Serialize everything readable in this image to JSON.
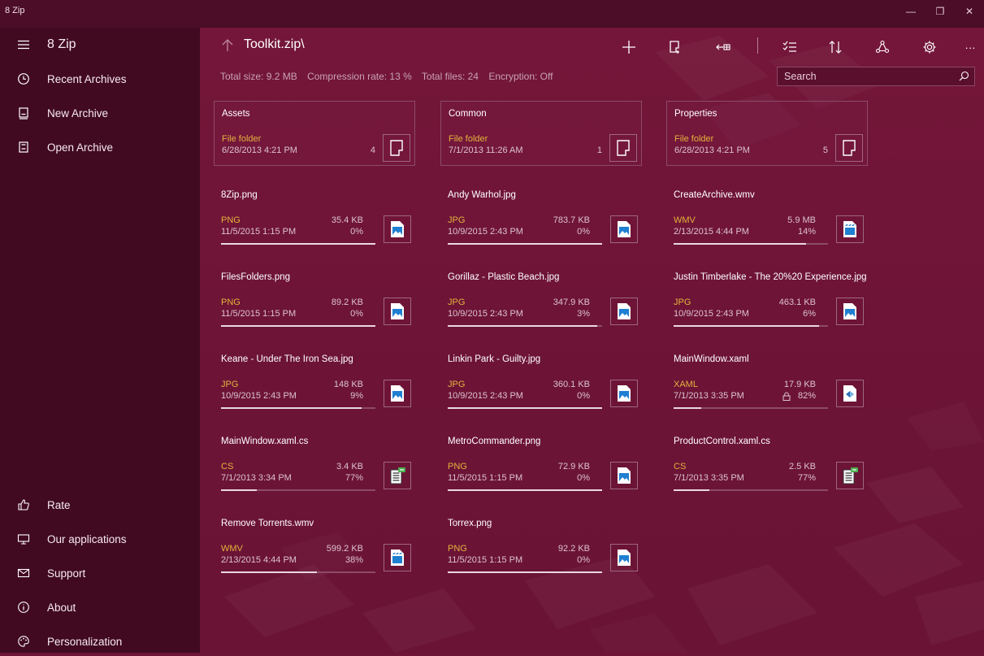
{
  "window": {
    "title": "8 Zip",
    "controls": {
      "minimize": "—",
      "restore": "❐",
      "close": "✕"
    }
  },
  "sidebar": {
    "menu_icon": "hamburger-icon",
    "app_name": "8 Zip",
    "top_items": [
      {
        "label": "Recent Archives",
        "icon": "clock-icon"
      },
      {
        "label": "New Archive",
        "icon": "new-archive-icon"
      },
      {
        "label": "Open Archive",
        "icon": "open-archive-icon"
      }
    ],
    "bottom_items": [
      {
        "label": "Rate",
        "icon": "thumbs-up-icon"
      },
      {
        "label": "Our applications",
        "icon": "apps-icon"
      },
      {
        "label": "Support",
        "icon": "mail-icon"
      },
      {
        "label": "About",
        "icon": "info-icon"
      },
      {
        "label": "Personalization",
        "icon": "palette-icon"
      }
    ]
  },
  "toolbar": {
    "path": "Toolkit.zip\\",
    "buttons": [
      "add-icon",
      "extract-icon",
      "back-to-folder-icon",
      "select-icon",
      "sort-icon",
      "share-icon",
      "settings-icon",
      "more-icon"
    ],
    "more_glyph": "···"
  },
  "stats": {
    "total_size": "Total size: 9.2 MB",
    "compression_rate": "Compression rate: 13 %",
    "total_files": "Total files: 24",
    "encryption": "Encryption: Off"
  },
  "search": {
    "placeholder": "Search",
    "value": ""
  },
  "folders": [
    {
      "name": "Assets",
      "type": "File folder",
      "date": "6/28/2013 4:21 PM",
      "count": "4"
    },
    {
      "name": "Common",
      "type": "File folder",
      "date": "7/1/2013 11:26 AM",
      "count": "1"
    },
    {
      "name": "Properties",
      "type": "File folder",
      "date": "6/28/2013 4:21 PM",
      "count": "5"
    }
  ],
  "files": [
    {
      "name": "8Zip.png",
      "type": "PNG",
      "date": "11/5/2015 1:15 PM",
      "size": "35.4 KB",
      "pct": "0%",
      "progress": 1.0,
      "icon": "image-file-icon"
    },
    {
      "name": "Andy Warhol.jpg",
      "type": "JPG",
      "date": "10/9/2015 2:43 PM",
      "size": "783.7 KB",
      "pct": "0%",
      "progress": 1.0,
      "icon": "image-file-icon"
    },
    {
      "name": "CreateArchive.wmv",
      "type": "WMV",
      "date": "2/13/2015 4:44 PM",
      "size": "5.9 MB",
      "pct": "14%",
      "progress": 0.86,
      "icon": "video-file-icon"
    },
    {
      "name": "FilesFolders.png",
      "type": "PNG",
      "date": "11/5/2015 1:15 PM",
      "size": "89.2 KB",
      "pct": "0%",
      "progress": 1.0,
      "icon": "image-file-icon"
    },
    {
      "name": "Gorillaz - Plastic Beach.jpg",
      "type": "JPG",
      "date": "10/9/2015 2:43 PM",
      "size": "347.9 KB",
      "pct": "3%",
      "progress": 0.97,
      "icon": "image-file-icon"
    },
    {
      "name": "Justin Timberlake - The 20%20 Experience.jpg",
      "type": "JPG",
      "date": "10/9/2015 2:43 PM",
      "size": "463.1 KB",
      "pct": "6%",
      "progress": 0.94,
      "icon": "image-file-icon"
    },
    {
      "name": "Keane - Under The Iron Sea.jpg",
      "type": "JPG",
      "date": "10/9/2015 2:43 PM",
      "size": "148 KB",
      "pct": "9%",
      "progress": 0.91,
      "icon": "image-file-icon"
    },
    {
      "name": "Linkin Park - Guilty.jpg",
      "type": "JPG",
      "date": "10/9/2015 2:43 PM",
      "size": "360.1 KB",
      "pct": "0%",
      "progress": 1.0,
      "icon": "image-file-icon"
    },
    {
      "name": "MainWindow.xaml",
      "type": "XAML",
      "date": "7/1/2013 3:35 PM",
      "size": "17.9 KB",
      "pct": "82%",
      "progress": 0.18,
      "icon": "xaml-file-icon",
      "locked": true
    },
    {
      "name": "MainWindow.xaml.cs",
      "type": "CS",
      "date": "7/1/2013 3:34 PM",
      "size": "3.4 KB",
      "pct": "77%",
      "progress": 0.23,
      "icon": "code-file-icon"
    },
    {
      "name": "MetroCommander.png",
      "type": "PNG",
      "date": "11/5/2015 1:15 PM",
      "size": "72.9 KB",
      "pct": "0%",
      "progress": 1.0,
      "icon": "image-file-icon"
    },
    {
      "name": "ProductControl.xaml.cs",
      "type": "CS",
      "date": "7/1/2013 3:35 PM",
      "size": "2.5 KB",
      "pct": "77%",
      "progress": 0.23,
      "icon": "code-file-icon"
    },
    {
      "name": "Remove Torrents.wmv",
      "type": "WMV",
      "date": "2/13/2015 4:44 PM",
      "size": "599.2 KB",
      "pct": "38%",
      "progress": 0.62,
      "icon": "video-file-icon"
    },
    {
      "name": "Torrex.png",
      "type": "PNG",
      "date": "11/5/2015 1:15 PM",
      "size": "92.2 KB",
      "pct": "0%",
      "progress": 1.0,
      "icon": "image-file-icon"
    }
  ],
  "colors": {
    "accent": "#6e1437",
    "sidebar": "#410a21",
    "titlebar": "#4b0d27",
    "file_type": "#e3b23c",
    "icon_blue": "#1f7fd1"
  }
}
